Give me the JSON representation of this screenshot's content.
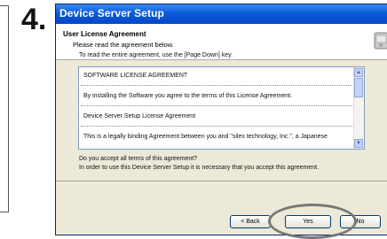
{
  "step_number": "4.",
  "window": {
    "title": "Device Server Setup",
    "header_title": "User License Agreement",
    "header_subtitle": "Please read the agreement below.",
    "icon": "setup-computer-icon"
  },
  "intro_text": "To read the entire agreement, use the [Page Down] key.",
  "license": {
    "lines": [
      "SOFTWARE LICENSE AGREEMENT",
      "By installing the Software you agree to the terms of this License Agreement.",
      "Device Server Setup License Agreement",
      "This is a legally binding Agreement between you and \"silex technology, Inc.\", a Japanese"
    ]
  },
  "question": "Do you accept all terms of this agreement?",
  "question_sub": "In order to use this Device Server Setup it is necessary that you accept this agreement.",
  "buttons": {
    "back": "< Back",
    "yes": "Yes",
    "no": "No"
  },
  "colors": {
    "titlebar": "#0a5bd9",
    "highlight": "#777777"
  }
}
